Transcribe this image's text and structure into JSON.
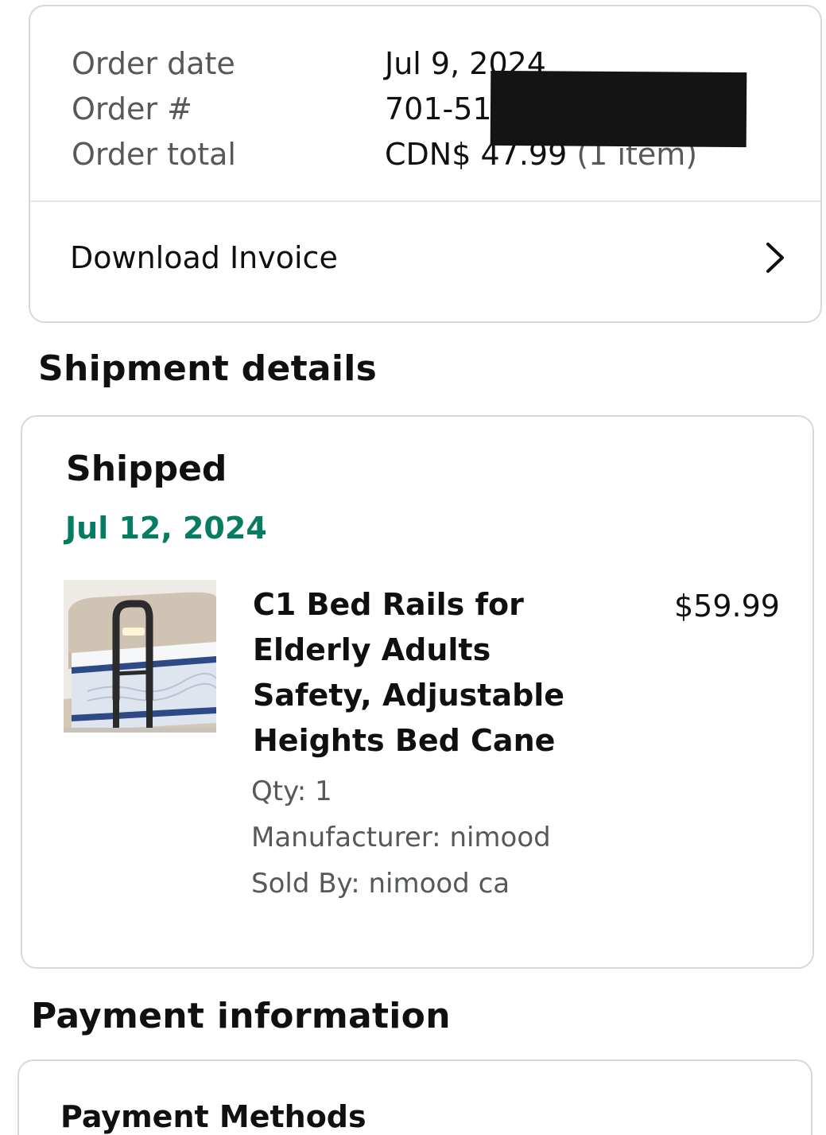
{
  "order_summary": {
    "rows": [
      {
        "label": "Order date",
        "value": "Jul 9, 2024"
      },
      {
        "label": "Order #",
        "value": "701-512…608"
      },
      {
        "label": "Order total",
        "value": "CDN$ 47.99",
        "suffix": "(1 item)"
      }
    ],
    "download_invoice_label": "Download Invoice"
  },
  "shipment": {
    "heading": "Shipment details",
    "status": "Shipped",
    "date": "Jul 12, 2024",
    "item": {
      "title": "C1 Bed Rails for Elderly Adults Safety, Adjustable Heights Bed Cane",
      "price": "$59.99",
      "qty": "Qty: 1",
      "manufacturer": "Manufacturer: nimood",
      "sold_by": "Sold By: nimood ca"
    }
  },
  "payment": {
    "heading": "Payment information",
    "methods_title": "Payment Methods"
  },
  "colors": {
    "accent_green": "#067d62",
    "text_primary": "#0f1111",
    "text_secondary": "#565959",
    "border": "#d5d9d9"
  },
  "icons": {
    "invoice_chevron": "chevron-right-icon"
  }
}
